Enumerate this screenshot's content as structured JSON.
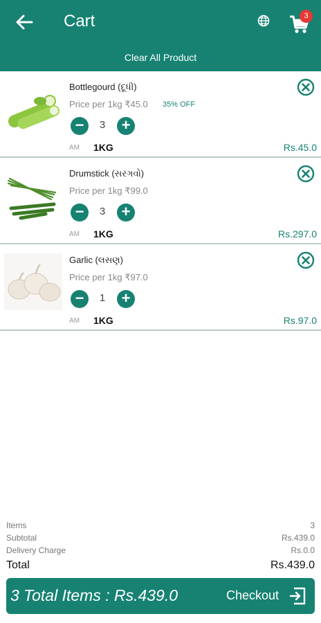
{
  "header": {
    "title": "Cart",
    "cart_count": "3",
    "clear_all_label": "Clear All Product",
    "icons": [
      "back-arrow-icon",
      "globe-icon",
      "cart-icon"
    ]
  },
  "items": [
    {
      "name": "Bottlegourd (દૂધી)",
      "price": "Price per 1kg ₹45.0",
      "discount": "35% OFF",
      "quantity": "3",
      "am": "AM",
      "unit": "1KG",
      "total": "Rs.45.0",
      "image": "bottlegourd"
    },
    {
      "name": "Drumstick (સરગવો)",
      "price": "Price per 1kg ₹99.0",
      "discount": "",
      "quantity": "3",
      "am": "AM",
      "unit": "1KG",
      "total": "Rs.297.0",
      "image": "drumstick"
    },
    {
      "name": "Garlic (લસણ)",
      "price": "Price per 1kg ₹97.0",
      "discount": "",
      "quantity": "1",
      "am": "AM",
      "unit": "1KG",
      "total": "Rs.97.0",
      "image": "garlic"
    }
  ],
  "summary": {
    "items_label": "Items",
    "items_value": "3",
    "subtotal_label": "Subtotal",
    "subtotal_value": "Rs.439.0",
    "delivery_label": "Delivery Charge",
    "delivery_value": "Rs.0.0",
    "total_label": "Total",
    "total_value": "Rs.439.0"
  },
  "checkout": {
    "summary_text": "3 Total Items : Rs.439.0",
    "label": "Checkout"
  },
  "colors": {
    "primary": "#178272",
    "badge": "#e53935"
  }
}
